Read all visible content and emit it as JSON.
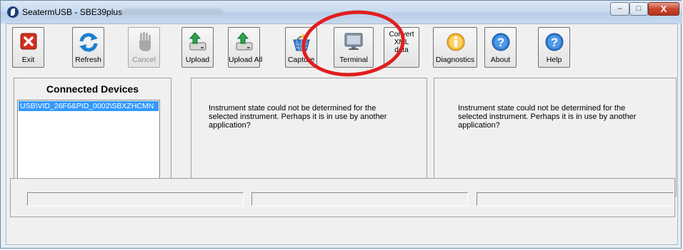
{
  "window": {
    "title": "SeatermUSB - SBE39plus",
    "controls": {
      "minimize": "–",
      "maximize": "□",
      "close": "X"
    }
  },
  "toolbar": {
    "exit": "Exit",
    "refresh": "Refresh",
    "cancel": "Cancel",
    "upload": "Upload",
    "upload_all": "Upload All",
    "capture": "Capture",
    "terminal": "Terminal",
    "convert_line1": "Convert",
    "convert_line2": "XML",
    "convert_line3": "data",
    "diagnostics": "Diagnostics",
    "about": "About",
    "help": "Help"
  },
  "devices": {
    "title": "Connected Devices",
    "items": [
      "USB\\VID_26F6&PID_0002\\SBXZHCMN"
    ]
  },
  "status_panels": {
    "middle_message": "Instrument state could not be determined for the selected instrument.  Perhaps it is in use by another application?",
    "right_message": "Instrument state could not be determined for the selected instrument.  Perhaps it is in use by another application?"
  },
  "colors": {
    "selection": "#3399ff",
    "annotation": "#e01e1e"
  }
}
